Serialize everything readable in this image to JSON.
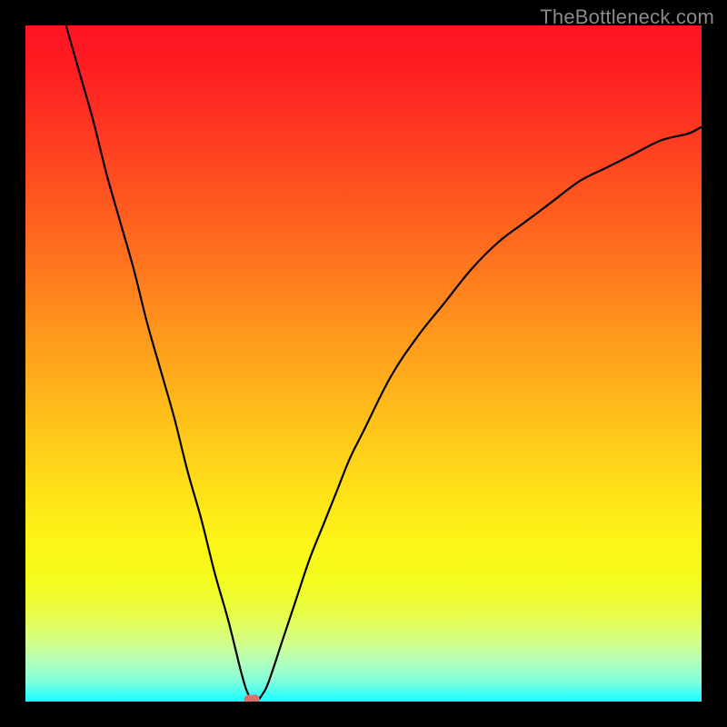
{
  "watermark": "TheBottleneck.com",
  "chart_data": {
    "type": "line",
    "title": "",
    "xlabel": "",
    "ylabel": "",
    "xlim": [
      0,
      100
    ],
    "ylim": [
      0,
      100
    ],
    "grid": false,
    "legend": false,
    "background": "rainbow-gradient",
    "series": [
      {
        "name": "bottleneck-curve",
        "x": [
          6,
          8,
          10,
          12,
          14,
          16,
          18,
          20,
          22,
          24,
          26,
          28,
          30,
          32,
          33,
          34,
          35,
          36,
          38,
          40,
          42,
          44,
          46,
          48,
          50,
          54,
          58,
          62,
          66,
          70,
          74,
          78,
          82,
          86,
          90,
          94,
          98,
          100
        ],
        "values": [
          100,
          93,
          86,
          78,
          71,
          64,
          56,
          49,
          42,
          34,
          27,
          19,
          12,
          4,
          1,
          0,
          1,
          3,
          9,
          15,
          21,
          26,
          31,
          36,
          40,
          48,
          54,
          59,
          64,
          68,
          71,
          74,
          77,
          79,
          81,
          83,
          84,
          85
        ]
      }
    ],
    "markers": [
      {
        "name": "optimal-point",
        "x": 33.5,
        "y": 0.3
      }
    ]
  }
}
